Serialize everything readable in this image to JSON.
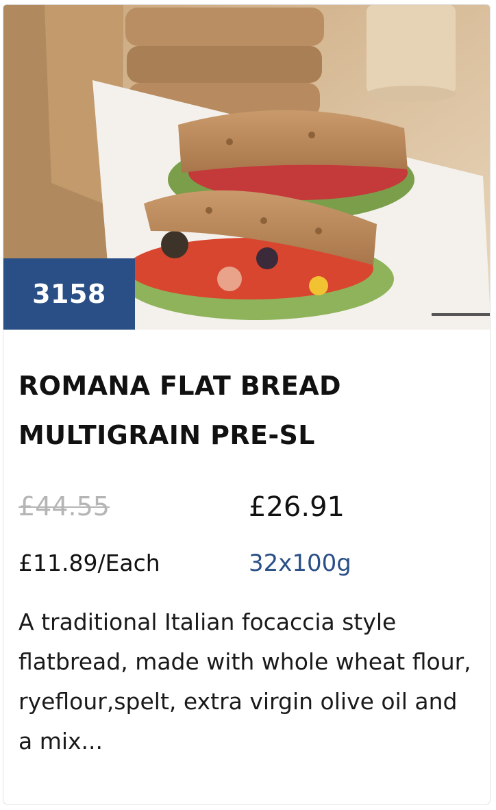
{
  "product": {
    "code": "3158",
    "title_line1": "ROMANA FLAT BREAD",
    "title_line2": "MULTIGRAIN PRE-SL",
    "old_price": "£44.55",
    "new_price": "£26.91",
    "unit_price": "£11.89/Each",
    "pack_size": "32x100g",
    "description": "A traditional Italian focaccia style flatbread, made with whole wheat flour, ryeflour,spelt, extra virgin olive oil and a mix..."
  },
  "colors": {
    "badge_bg": "#2a4f86",
    "pack_size_text": "#2a4f86",
    "old_price_text": "#b5b5b5"
  },
  "icons": {
    "product_image": "sandwich-photo"
  }
}
